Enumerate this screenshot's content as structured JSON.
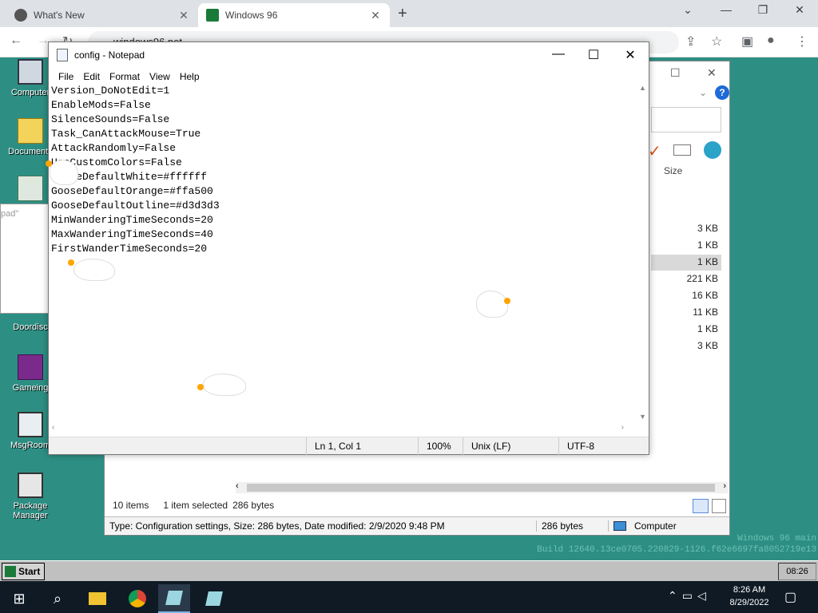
{
  "browser": {
    "tabs": [
      {
        "label": "What's New",
        "active": false
      },
      {
        "label": "Windows 96",
        "active": true
      }
    ],
    "url": "windows96.net"
  },
  "desktop_icons": [
    "Computer",
    "Documents",
    "Doordisc",
    "Gameing",
    "MsgRoom",
    "Package Manager"
  ],
  "left_dialog_title": "pad\"",
  "explorer": {
    "size_header": "Size",
    "file_sizes": [
      "3 KB",
      "1 KB",
      "1 KB",
      "221 KB",
      "16 KB",
      "11 KB",
      "1 KB",
      "3 KB"
    ],
    "item_count": "10 items",
    "selected": "1 item selected",
    "selected_size": "286 bytes",
    "status_type": "Type: Configuration settings, Size: 286 bytes, Date modified: 2/9/2020 9:48 PM",
    "status_size": "286 bytes",
    "status_location": "Computer"
  },
  "notepad": {
    "title": "config - Notepad",
    "menu": [
      "File",
      "Edit",
      "Format",
      "View",
      "Help"
    ],
    "content": "Version_DoNotEdit=1\nEnableMods=False\nSilenceSounds=False\nTask_CanAttackMouse=True\nAttackRandomly=False\nUseCustomColors=False\nGooseDefaultWhite=#ffffff\nGooseDefaultOrange=#ffa500\nGooseDefaultOutline=#d3d3d3\nMinWanderingTimeSeconds=20\nMaxWanderingTimeSeconds=40\nFirstWanderTimeSeconds=20",
    "status": {
      "position": "Ln 1, Col 1",
      "zoom": "100%",
      "line_ending": "Unix (LF)",
      "encoding": "UTF-8"
    }
  },
  "watermark": {
    "line1": "Windows 96 main",
    "line2": "Build 12640.13ce0705.220829-1126.f62e6697fa8052719e13"
  },
  "w96_taskbar": {
    "start_label": "Start",
    "clock": "08:26"
  },
  "win_taskbar": {
    "time": "8:26 AM",
    "date": "8/29/2022"
  }
}
